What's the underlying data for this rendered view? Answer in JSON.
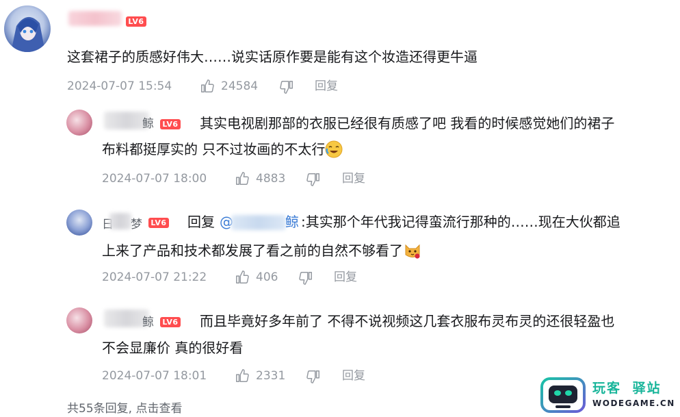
{
  "main_comment": {
    "user_name": "",
    "level": "LV6",
    "text": "这套裙子的质感好伟大……说实话原作要是能有这个妆造还得更牛逼",
    "date": "2024-07-07 15:54",
    "likes": "24584",
    "reply_label": "回复"
  },
  "replies": [
    {
      "user_name_visible_start": "",
      "user_name_visible_end": "鲸",
      "level": "LV6",
      "text_line1": "其实电视剧那部的衣服已经很有质感了吧 我看的时候感觉她们的裙子",
      "text_line2": "布料都挺厚实的 只不过妆画的不太行",
      "emoji": "laughing-crying-emoji",
      "date": "2024-07-07 18:00",
      "likes": "4883",
      "reply_label": "回复"
    },
    {
      "user_name_visible_start": "日",
      "user_name_visible_end": "梦",
      "level": "LV6",
      "reply_prefix": "回复",
      "mention_prefix": "@",
      "mention_suffix": "鲸",
      "text_line1": ":其实那个年代我记得蛮流行那种的……现在大伙都追",
      "text_line2": "上来了产品和技术都发展了看之前的自然不够看了",
      "emoji": "cat-rose-emoji",
      "date": "2024-07-07 21:22",
      "likes": "406",
      "reply_label": "回复"
    },
    {
      "user_name_visible_start": "",
      "user_name_visible_end": "鲸",
      "level": "LV6",
      "text_line1": "而且毕竟好多年前了 不得不说视频这几套衣服布灵布灵的还很轻盈也",
      "text_line2": "不会显廉价 真的很好看",
      "date": "2024-07-07 18:01",
      "likes": "2331",
      "reply_label": "回复"
    }
  ],
  "footer": {
    "view_more": "共55条回复, 点击查看"
  },
  "watermark": {
    "brand_cn_part1": "玩客",
    "brand_cn_part2": "驿站",
    "domain": "WODEGAME.CN"
  },
  "colors": {
    "level_badge": "#ff4d4f",
    "meta_gray": "#9499a0",
    "mention_blue": "#3a7bd5",
    "watermark_teal": "#18b59a"
  }
}
